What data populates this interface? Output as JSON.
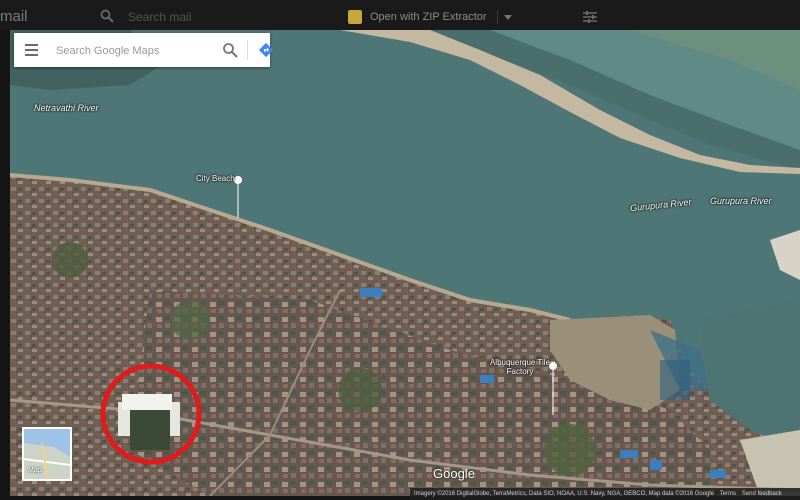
{
  "chrome": {
    "brand": "mail",
    "mail_search_placeholder": "Search mail",
    "zip_label": "Open with ZIP Extractor"
  },
  "maps": {
    "search_placeholder": "Search Google Maps",
    "places": {
      "netravathi": "Netravathi River",
      "city_beach": "City Beach",
      "gurupura_1": "Gurupura River",
      "gurupura_2": "Gurupura River",
      "factory": "Albuquerque Tile Factory"
    },
    "thumbnail_label": "Map",
    "logo": "Google",
    "footer": {
      "imagery": "Imagery ©2016 DigitalGlobe, TerraMetrics, Data SIO, NOAA, U.S. Navy, NGA, GEBCO, Map data ©2016 Google",
      "terms": "Terms",
      "feedback": "Send feedback"
    }
  },
  "colors": {
    "river": "#4d7474",
    "land": "#6b5d52",
    "highlight_circle": "#e01b1b",
    "directions": "#4285f4"
  }
}
